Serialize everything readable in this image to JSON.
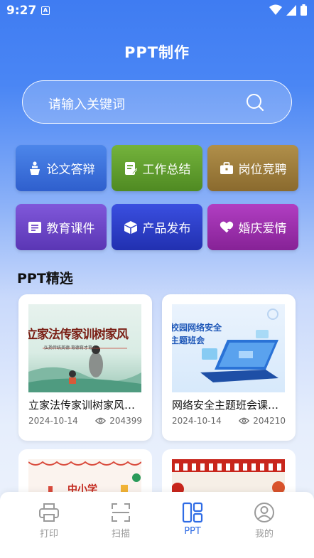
{
  "status": {
    "time": "9:27",
    "a_badge": "A"
  },
  "header": {
    "title": "PPT制作"
  },
  "search": {
    "placeholder": "请输入关键词"
  },
  "categories": [
    {
      "label": "论文答辩",
      "color": "#3b6fd6"
    },
    {
      "label": "工作总结",
      "color": "#5e9d2b"
    },
    {
      "label": "岗位竞聘",
      "color": "#9b7b3b"
    },
    {
      "label": "教育课件",
      "color": "#6d45c7"
    },
    {
      "label": "产品发布",
      "color": "#2d3bc7"
    },
    {
      "label": "婚庆爱情",
      "color": "#9a2dab"
    }
  ],
  "section": {
    "title": "PPT精选"
  },
  "cards": [
    {
      "title": "立家法传家训树家风传家…",
      "date": "2024-10-14",
      "views": "204399",
      "thumb_text": "立家法传家训树家风",
      "thumb_sub": "弘扬传统美德 育德育才育人"
    },
    {
      "title": "网络安全主题班会课件…",
      "date": "2024-10-14",
      "views": "204210",
      "thumb_text1": "校园网络安全",
      "thumb_text2": "主题班会"
    },
    {
      "thumb_text": "中小学"
    },
    {
      "thumb_text": ""
    }
  ],
  "tabs": [
    {
      "label": "打印"
    },
    {
      "label": "扫描"
    },
    {
      "label": "PPT"
    },
    {
      "label": "我的"
    }
  ],
  "colors": {
    "accent": "#2f6ce5",
    "inactive": "#9a9a9a"
  }
}
